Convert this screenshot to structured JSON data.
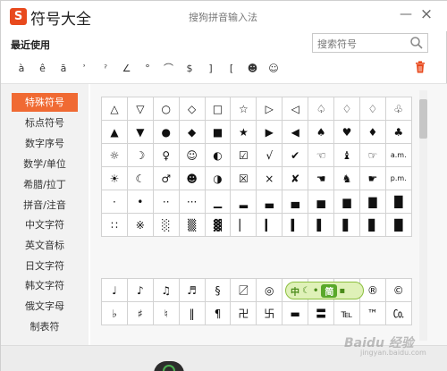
{
  "app": {
    "logo_letter": "S",
    "title": "符号大全",
    "center_title": "搜狗拼音输入法"
  },
  "window_buttons": {
    "minimize": "—",
    "close": "×"
  },
  "recent": {
    "label": "最近使用",
    "items": [
      "à",
      "ê",
      "ā",
      "ʾ",
      "ˀ",
      "∠",
      "°",
      "⌒",
      "$",
      "]",
      "[",
      "☻",
      "☺"
    ]
  },
  "search": {
    "placeholder": "搜索符号"
  },
  "sidebar": {
    "items": [
      {
        "label": "特殊符号",
        "active": true
      },
      {
        "label": "标点符号"
      },
      {
        "label": "数字序号"
      },
      {
        "label": "数学/单位"
      },
      {
        "label": "希腊/拉丁"
      },
      {
        "label": "拼音/注音"
      },
      {
        "label": "中文字符"
      },
      {
        "label": "英文音标"
      },
      {
        "label": "日文字符"
      },
      {
        "label": "韩文字符"
      },
      {
        "label": "俄文字母"
      },
      {
        "label": "制表符"
      }
    ]
  },
  "symbols_grid": {
    "rows": [
      [
        "△",
        "▽",
        "○",
        "◇",
        "□",
        "☆",
        "▷",
        "◁",
        "♤",
        "♢",
        "♢",
        "♧"
      ],
      [
        "▲",
        "▼",
        "●",
        "◆",
        "■",
        "★",
        "▶",
        "◀",
        "♠",
        "♥",
        "♦",
        "♣"
      ],
      [
        "☼",
        "☽",
        "♀",
        "☺",
        "◐",
        "☑",
        "√",
        "✔",
        "☜",
        "♝",
        "☞",
        "a.m."
      ],
      [
        "☀",
        "☾",
        "♂",
        "☻",
        "◑",
        "☒",
        "×",
        "✘",
        "☚",
        "♞",
        "☛",
        "p.m."
      ],
      [
        "·",
        "•",
        "··",
        "···",
        "▁",
        "▂",
        "▃",
        "▄",
        "▅",
        "▆",
        "▇",
        "█"
      ],
      [
        "∷",
        "※",
        "░",
        "▒",
        "▓",
        "▏",
        "▎",
        "▍",
        "▌",
        "▋",
        "▊",
        "█"
      ]
    ]
  },
  "music_grid": {
    "rows": [
      [
        "♩",
        "♪",
        "♫",
        "♬",
        "§",
        "〼",
        "◎",
        "",
        "",
        "",
        "®",
        "©"
      ],
      [
        "♭",
        "♯",
        "♮",
        "‖",
        "¶",
        "卍",
        "卐",
        "▬",
        "〓",
        "℡",
        "™",
        "㏇"
      ]
    ]
  },
  "ime_toolbar": {
    "text_1": "中",
    "text_2": "简"
  },
  "watermark": {
    "text": "Baidu 经验",
    "sub": "jingyan.baidu.com"
  }
}
